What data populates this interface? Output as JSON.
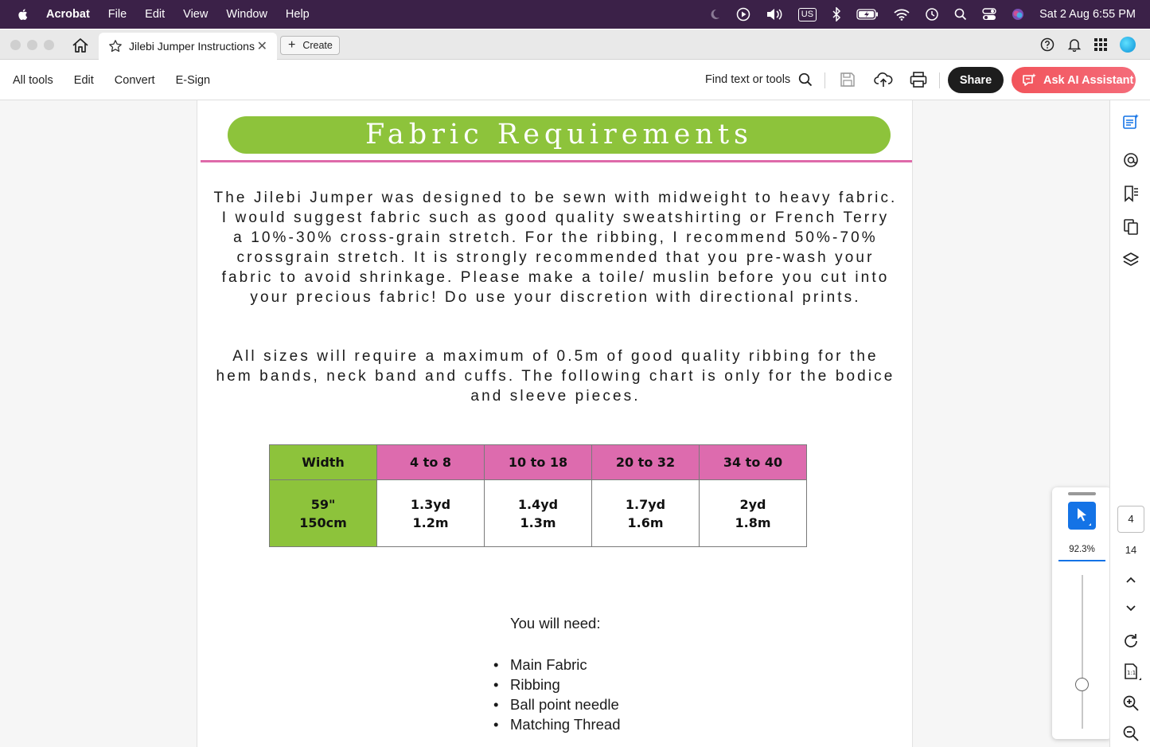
{
  "menubar": {
    "app": "Acrobat",
    "items": [
      "File",
      "Edit",
      "View",
      "Window",
      "Help"
    ],
    "keyboard": "US",
    "datetime": "Sat 2 Aug  6:55 PM"
  },
  "tabbar": {
    "tab_title": "Jilebi Jumper Instructions",
    "create_label": "Create"
  },
  "toolbar": {
    "menu": [
      "All tools",
      "Edit",
      "Convert",
      "E-Sign"
    ],
    "find_label": "Find text or tools",
    "share_label": "Share",
    "ai_label": "Ask AI Assistant"
  },
  "document": {
    "heading": "Fabric Requirements",
    "paragraph1": "The Jilebi Jumper was designed to be sewn with midweight to heavy fabric. I would suggest fabric such as good quality sweatshirting or French Terry a 10%-30% cross-grain stretch. For the ribbing, I recommend 50%-70% crossgrain stretch. It is strongly recommended that you pre-wash your fabric to avoid shrinkage. Please make a toile/ muslin before you cut into your precious fabric! Do use your discretion with directional prints.",
    "paragraph2": "All sizes will require a maximum of 0.5m of good quality ribbing for the hem bands, neck band and cuffs. The following chart is only for the bodice and sleeve pieces.",
    "table": {
      "header": [
        "Width",
        "4 to 8",
        "10 to 18",
        "20 to 32",
        "34 to 40"
      ],
      "row": [
        [
          "59\"",
          "150cm"
        ],
        [
          "1.3yd",
          "1.2m"
        ],
        [
          "1.4yd",
          "1.3m"
        ],
        [
          "1.7yd",
          "1.6m"
        ],
        [
          "2yd",
          "1.8m"
        ]
      ]
    },
    "need_title": "You will need:",
    "need_items": [
      "Main Fabric",
      "Ribbing",
      "Ball point needle",
      "Matching Thread"
    ]
  },
  "zoom": {
    "percent": "92.3%",
    "level": 0.3
  },
  "pager": {
    "current": "4",
    "total": "14"
  },
  "colors": {
    "banner_green": "#8dc33b",
    "pink": "#dd6bae",
    "menubar": "#3b2148",
    "accent_blue": "#1473e6"
  }
}
